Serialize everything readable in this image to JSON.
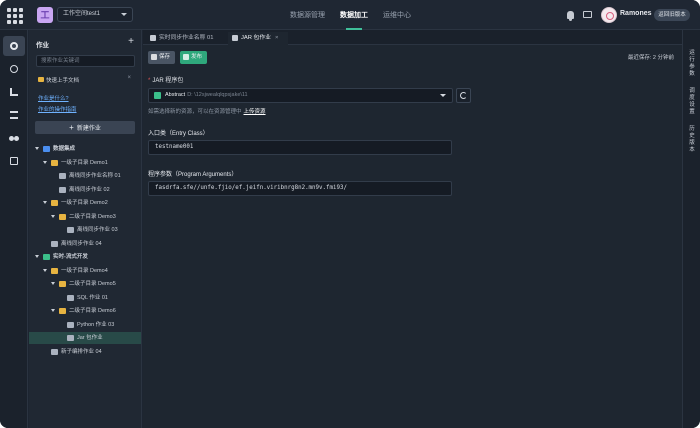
{
  "header": {
    "logo_letter": "工",
    "workspace": "工作空间test1",
    "nav": [
      {
        "label": "数据源管理",
        "active": false
      },
      {
        "label": "数据加工",
        "active": true
      },
      {
        "label": "运维中心",
        "active": false
      }
    ],
    "username": "Ramones",
    "old_version_button": "返回旧版本",
    "accent_color": "#3fbf9a"
  },
  "rail_icons": [
    "gear-icon",
    "globe-icon",
    "flow-icon",
    "list-icon",
    "circles-icon",
    "square-icon"
  ],
  "sidebar": {
    "title": "作业",
    "add_label": "+",
    "search_placeholder": "搜索作业关键词",
    "quick_start": "快速上手文档",
    "quick_close": "×",
    "links": [
      "作业是什么?",
      "作业的操作指南"
    ],
    "new_job_button": "新建作业",
    "tree": [
      {
        "label": "数据集成",
        "level": 0,
        "type": "cat",
        "expanded": true
      },
      {
        "label": "一级子目录 Demo1",
        "level": 1,
        "type": "folder",
        "expanded": true
      },
      {
        "label": "离线同步作业名称 01",
        "level": 2,
        "type": "file"
      },
      {
        "label": "离线同步作业 02",
        "level": 2,
        "type": "file"
      },
      {
        "label": "一级子目录 Demo2",
        "level": 1,
        "type": "folder",
        "expanded": true
      },
      {
        "label": "二级子目录 Demo3",
        "level": 2,
        "type": "folder",
        "expanded": true
      },
      {
        "label": "离线同步作业 03",
        "level": 3,
        "type": "file"
      },
      {
        "label": "离线同步作业 04",
        "level": 1,
        "type": "file"
      },
      {
        "label": "实时-流式开发",
        "level": 0,
        "type": "cat2",
        "expanded": true
      },
      {
        "label": "一级子目录 Demo4",
        "level": 1,
        "type": "folder",
        "expanded": true
      },
      {
        "label": "二级子目录 Demo5",
        "level": 2,
        "type": "folder",
        "expanded": true
      },
      {
        "label": "SQL 作业 01",
        "level": 3,
        "type": "file"
      },
      {
        "label": "二级子目录 Demo6",
        "level": 2,
        "type": "folder",
        "expanded": true
      },
      {
        "label": "Python 作业 03",
        "level": 3,
        "type": "file"
      },
      {
        "label": "Jar 包作业",
        "level": 3,
        "type": "file",
        "selected": true
      },
      {
        "label": "新子编排作业 04",
        "level": 1,
        "type": "file"
      }
    ]
  },
  "tabs": [
    {
      "label": "实时同步作业名称 01",
      "close": "×",
      "active": false
    },
    {
      "label": "JAR 包作业",
      "close": "×",
      "active": true
    }
  ],
  "toolbar": {
    "save_label": "保存",
    "submit_label": "发布",
    "autosave": "最近保存: 2 分钟前"
  },
  "form": {
    "jar_label": "JAR 程序包",
    "jar_required": "*",
    "jar_name": "Abstract",
    "jar_path": "D: \\12sjwealqlqpsjake\\11",
    "hint_text": "如需选择新的资源，可以在资源管理中",
    "hint_link": "上传资源",
    "entry_label": "入口类（Entry Class）",
    "entry_value": "testname001",
    "args_label": "程序参数（Program Arguments）",
    "args_value": "fasdrfa.sfe//unfe.fjio/ef.jeifn.viribnrg8n2.mn9v.fmi93/"
  },
  "right_rail": [
    "运行参数",
    "调度设置",
    "历史版本"
  ]
}
